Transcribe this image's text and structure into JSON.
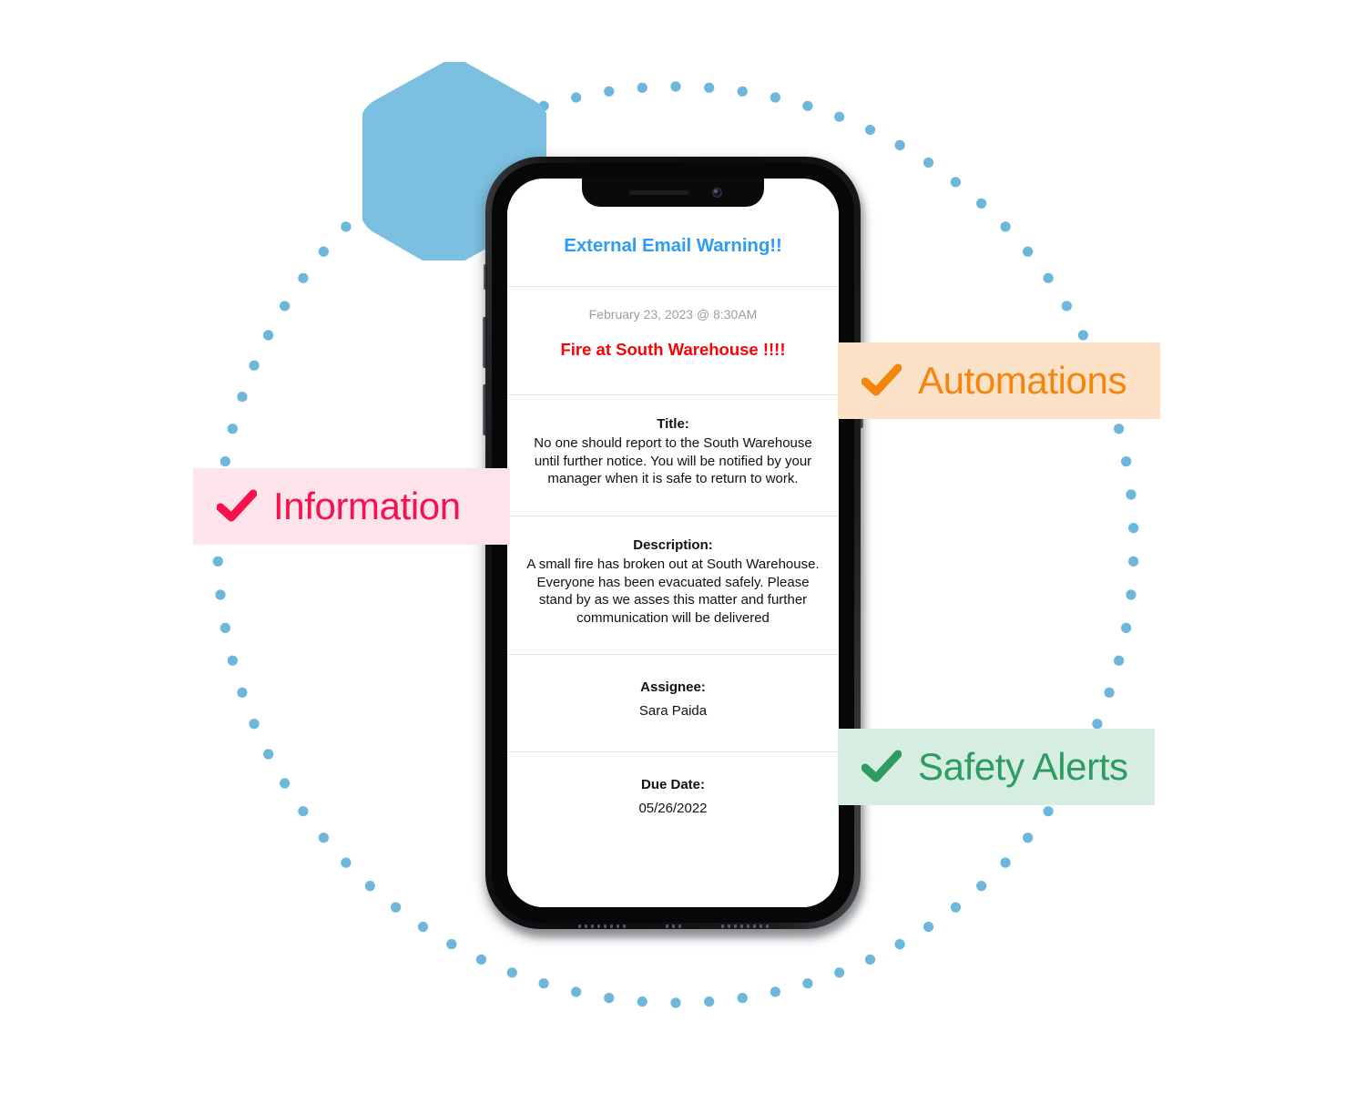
{
  "palette": {
    "hexagon": "#7cc0e1",
    "dot": "#6db6dc",
    "screen_bg": "#ffffff",
    "warning_blue": "#2f9bf5",
    "alert_red": "#f70505",
    "timestamp_gray": "#9d9d9d",
    "info_bg": "#fde3ea",
    "info_fg": "#f5124f",
    "automations_bg": "#fbe2c6",
    "automations_fg": "#f4850f",
    "safety_bg": "#d6eee1",
    "safety_fg": "#2e9b63"
  },
  "phone": {
    "screen": {
      "email_warning": "External Email Warning!!",
      "timestamp": "February 23, 2023 @ 8:30AM",
      "alert_title": "Fire at South Warehouse !!!!",
      "fields": [
        {
          "label": "Title:",
          "value": "No one should report to the South Warehouse until further notice.\nYou will be notified by your manager when it is safe to return to work."
        },
        {
          "label": "Description:",
          "value": "A small fire has broken out at South Warehouse. Everyone has been evacuated safely. Please stand by as we asses this matter and further communication will be delivered"
        },
        {
          "label": "Assignee:",
          "value": "Sara Paida"
        },
        {
          "label": "Due Date:",
          "value": "05/26/2022"
        }
      ]
    },
    "buttons": {
      "mute": "mute-switch",
      "volume_up": "volume-up-button",
      "volume_down": "volume-down-button",
      "power": "power-button"
    }
  },
  "badges": [
    {
      "id": "information",
      "label": "Information",
      "icon": "check-icon"
    },
    {
      "id": "automations",
      "label": "Automations",
      "icon": "check-icon"
    },
    {
      "id": "safety-alerts",
      "label": "Safety Alerts",
      "icon": "check-icon"
    }
  ],
  "decor": {
    "hexagon": "hexagon-shape",
    "dotted_circle": "dotted-circle-ring"
  }
}
